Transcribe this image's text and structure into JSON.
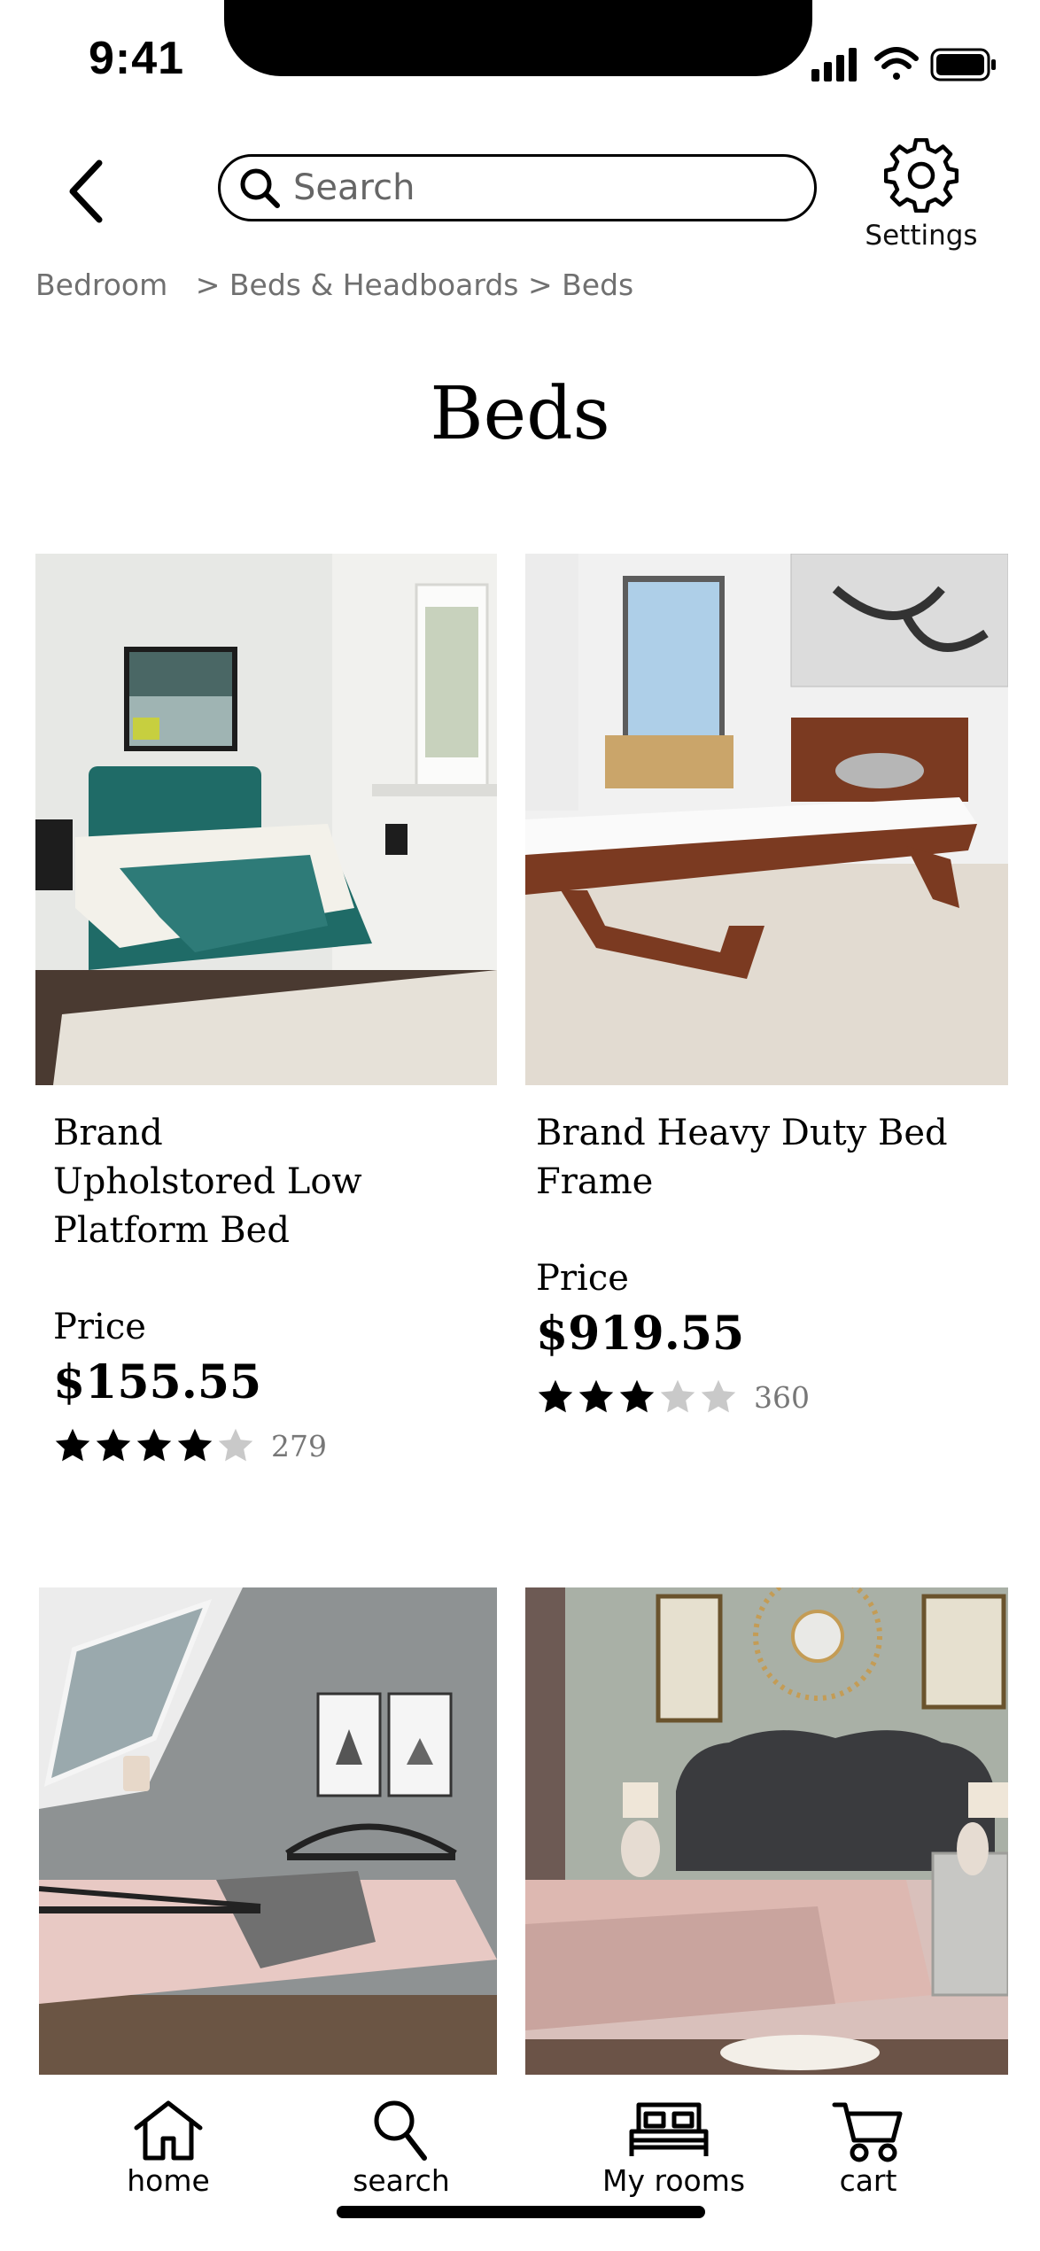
{
  "status_bar": {
    "time": "9:41"
  },
  "header": {
    "search_placeholder": "Search",
    "settings_label": "Settings"
  },
  "breadcrumb": {
    "items": [
      "Bedroom",
      "Beds & Headboards",
      "Beds"
    ],
    "separators": [
      ">",
      ">"
    ]
  },
  "page": {
    "title": "Beds"
  },
  "products": [
    {
      "name_lines": [
        "Brand",
        "Upholstored Low",
        "Platform Bed"
      ],
      "price_label": "Price",
      "price": "$155.55",
      "rating": 4,
      "rating_max": 5,
      "review_count": "279"
    },
    {
      "name_lines": [
        "Brand Heavy Duty Bed",
        "Frame"
      ],
      "price_label": "Price",
      "price": "$919.55",
      "rating": 3,
      "rating_max": 5,
      "review_count": "360"
    }
  ],
  "bottom_nav": {
    "items": [
      {
        "label": "home",
        "icon": "home-icon"
      },
      {
        "label": "search",
        "icon": "search-icon"
      },
      {
        "label": "My rooms",
        "icon": "bed-icon"
      },
      {
        "label": "cart",
        "icon": "cart-icon"
      }
    ]
  },
  "colors": {
    "star_filled": "#000000",
    "star_empty": "#c9c9c9",
    "breadcrumb_text": "#707070",
    "teal_headboard": "#1f6b67",
    "wood": "#7b3a21"
  }
}
